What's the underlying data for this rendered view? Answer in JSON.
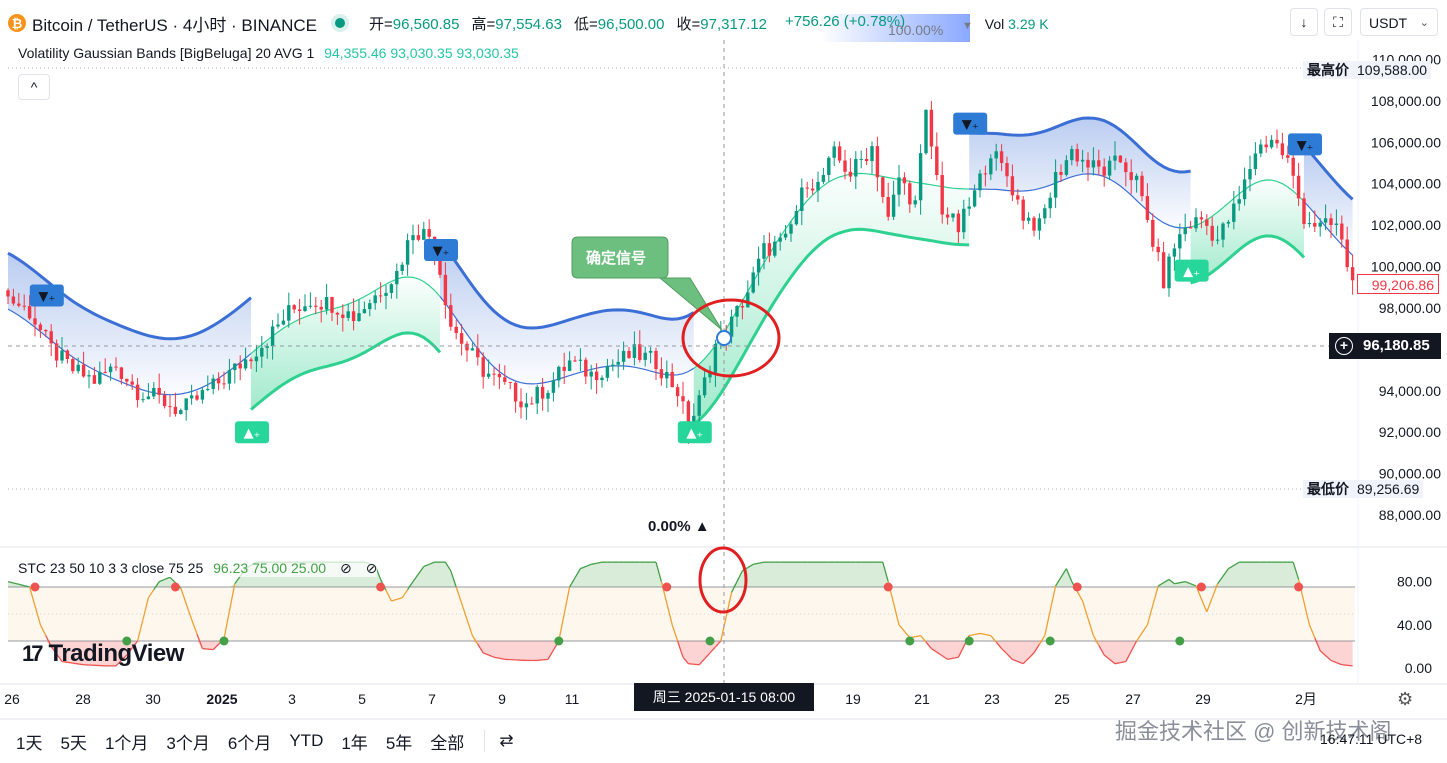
{
  "header": {
    "symbol": "Bitcoin / TetherUS · 4小时 · BINANCE",
    "coin_glyph": "₿",
    "open_label": "开=",
    "open": "96,560.85",
    "high_label": "高=",
    "high": "97,554.63",
    "low_label": "低=",
    "low": "96,500.00",
    "close_label": "收=",
    "close": "97,317.12",
    "change": "+756.26 (+0.78%)",
    "pct": "100.00%",
    "pct_triangle": "▼",
    "vol_label": "Vol",
    "vol": "3.29 K"
  },
  "toolbar": {
    "download_icon": "↓",
    "fullscreen_icon": "⛶",
    "currency": "USDT",
    "currency_chevron": "⌄"
  },
  "indicator": {
    "name": "Volatility Gaussian Bands [BigBeluga] 20 AVG 1",
    "v1": "94,355.46",
    "v2": "93,030.35",
    "v3": "93,030.35",
    "collapse": "^"
  },
  "stc": {
    "name": "STC 23 50 10 3 3 close 75 25",
    "v1": "96.23",
    "v2": "75.00",
    "v3": "25.00",
    "hide_icon": "⊘"
  },
  "annotation": {
    "callout": "确定信号",
    "pct_bottom": "0.00%  ▲"
  },
  "price_axis": {
    "ticks": [
      "110,000.00",
      "108,000.00",
      "106,000.00",
      "104,000.00",
      "102,000.00",
      "100,000.00",
      "98,000.00",
      "96,000.00",
      "94,000.00",
      "92,000.00",
      "90,000.00",
      "88,000.00"
    ],
    "high_label": "最高价",
    "high_value": "109,588.00",
    "low_label": "最低价",
    "low_value": "89,256.69",
    "last_price": "99,206.86",
    "crosshair_price": "96,180.85",
    "crosshair_plus": "+"
  },
  "stc_axis": {
    "ticks": [
      "80.00",
      "40.00",
      "0.00"
    ]
  },
  "time_axis": {
    "ticks": [
      "26",
      "28",
      "30",
      "2025",
      "3",
      "5",
      "7",
      "9",
      "11",
      "19",
      "21",
      "23",
      "25",
      "27",
      "29",
      "2月"
    ],
    "crosshair": "周三 2025-01-15   08:00",
    "settings_icon": "⚙"
  },
  "range_bar": {
    "items": [
      "1天",
      "5天",
      "1个月",
      "3个月",
      "6个月",
      "YTD",
      "1年",
      "5年",
      "全部"
    ],
    "compare_icon": "⇄"
  },
  "logo": {
    "mark": "17",
    "text": "TradingView"
  },
  "watermark": "掘金技术社区 @ 创新技术阁",
  "clock": "16:47:11 UTC+8",
  "colors": {
    "up": "#089981",
    "down": "#f23645",
    "upper_band": "#3b6fd6",
    "lower_band": "#2ed18f",
    "stc_up": "#43a047",
    "stc_down": "#ef5350",
    "stc_line": "#f0a030",
    "signal": "#2e7bd6",
    "callout": "#6dbf7f"
  },
  "chart_data": [
    {
      "type": "candlestick",
      "title": "Bitcoin / TetherUS · 4小时 · BINANCE",
      "ylim": [
        87000,
        111000
      ],
      "x_ticks": [
        "26",
        "28",
        "30",
        "2025",
        "3",
        "5",
        "7",
        "9",
        "11",
        "19",
        "21",
        "23",
        "25",
        "27",
        "29",
        "2月"
      ],
      "close_path": [
        [
          0,
          98500
        ],
        [
          4,
          97800
        ],
        [
          8,
          96000
        ],
        [
          12,
          95000
        ],
        [
          16,
          94500
        ],
        [
          20,
          95200
        ],
        [
          24,
          94000
        ],
        [
          28,
          93600
        ],
        [
          32,
          93000
        ],
        [
          36,
          93800
        ],
        [
          40,
          94600
        ],
        [
          44,
          95500
        ],
        [
          48,
          96500
        ],
        [
          52,
          97800
        ],
        [
          56,
          98400
        ],
        [
          60,
          98200
        ],
        [
          64,
          97600
        ],
        [
          68,
          98600
        ],
        [
          72,
          99700
        ],
        [
          75,
          101800
        ],
        [
          78,
          101500
        ],
        [
          80,
          99800
        ],
        [
          82,
          97200
        ],
        [
          85,
          96000
        ],
        [
          88,
          95000
        ],
        [
          92,
          94200
        ],
        [
          96,
          93400
        ],
        [
          100,
          94200
        ],
        [
          104,
          95400
        ],
        [
          108,
          94800
        ],
        [
          112,
          95300
        ],
        [
          116,
          95800
        ],
        [
          120,
          95400
        ],
        [
          124,
          94000
        ],
        [
          126,
          92200
        ],
        [
          128,
          93500
        ],
        [
          131,
          96200
        ],
        [
          134,
          97300
        ],
        [
          137,
          98800
        ],
        [
          140,
          100800
        ],
        [
          144,
          101200
        ],
        [
          148,
          104200
        ],
        [
          150,
          103900
        ],
        [
          153,
          105400
        ],
        [
          156,
          104500
        ],
        [
          160,
          105800
        ],
        [
          163,
          102200
        ],
        [
          165,
          104300
        ],
        [
          168,
          103000
        ],
        [
          170,
          107300
        ],
        [
          173,
          102800
        ],
        [
          176,
          101800
        ],
        [
          179,
          103500
        ],
        [
          182,
          105600
        ],
        [
          185,
          104400
        ],
        [
          188,
          102500
        ],
        [
          191,
          101900
        ],
        [
          194,
          104300
        ],
        [
          197,
          105600
        ],
        [
          200,
          104900
        ],
        [
          203,
          104600
        ],
        [
          206,
          105100
        ],
        [
          209,
          104100
        ],
        [
          212,
          101200
        ],
        [
          214,
          99300
        ],
        [
          216,
          101000
        ],
        [
          218,
          101900
        ],
        [
          221,
          102300
        ],
        [
          224,
          101300
        ],
        [
          228,
          103200
        ],
        [
          231,
          105600
        ],
        [
          234,
          106200
        ],
        [
          237,
          105100
        ],
        [
          240,
          102400
        ],
        [
          243,
          101900
        ],
        [
          246,
          102000
        ],
        [
          249,
          99200
        ]
      ],
      "range": {
        "high": 109588.0,
        "low": 89256.69
      },
      "last_price": 99206.86,
      "crosshair": {
        "date": "2025-01-15 08:00",
        "price": 96180.85
      },
      "series": [
        {
          "name": "Volatility Gaussian Bands [BigBeluga] 20 AVG 1",
          "values": [
            94355.46,
            93030.35,
            93030.35
          ]
        }
      ],
      "signals": [
        {
          "type": "sell",
          "bar": 7,
          "price": 98600
        },
        {
          "type": "buy",
          "bar": 45,
          "price": 92000
        },
        {
          "type": "sell",
          "bar": 80,
          "price": 100800
        },
        {
          "type": "buy",
          "bar": 127,
          "price": 92000
        },
        {
          "type": "sell",
          "bar": 178,
          "price": 106900
        },
        {
          "type": "buy",
          "bar": 219,
          "price": 99800
        },
        {
          "type": "sell",
          "bar": 240,
          "price": 105900
        }
      ]
    },
    {
      "type": "line",
      "title": "STC 23 50 10 3 3 close 75 25",
      "ylim": [
        0,
        100
      ],
      "series": [
        {
          "name": "STC",
          "values": [
            96.23,
            75.0,
            25.0
          ]
        }
      ],
      "path": [
        [
          0,
          80
        ],
        [
          4,
          75
        ],
        [
          6,
          40
        ],
        [
          8,
          20
        ],
        [
          10,
          6
        ],
        [
          14,
          3
        ],
        [
          18,
          2
        ],
        [
          20,
          2
        ],
        [
          22,
          12
        ],
        [
          24,
          25
        ],
        [
          26,
          65
        ],
        [
          28,
          80
        ],
        [
          30,
          84
        ],
        [
          32,
          74
        ],
        [
          34,
          45
        ],
        [
          36,
          18
        ],
        [
          38,
          17
        ],
        [
          40,
          27
        ],
        [
          42,
          78
        ],
        [
          44,
          92
        ],
        [
          46,
          98
        ],
        [
          50,
          98
        ],
        [
          54,
          98
        ],
        [
          58,
          98
        ],
        [
          62,
          98
        ],
        [
          64,
          98
        ],
        [
          66,
          98
        ],
        [
          68,
          95
        ],
        [
          69,
          82
        ],
        [
          71,
          62
        ],
        [
          73,
          65
        ],
        [
          75,
          80
        ],
        [
          77,
          94
        ],
        [
          79,
          98
        ],
        [
          81,
          98
        ],
        [
          82,
          90
        ],
        [
          84,
          60
        ],
        [
          86,
          30
        ],
        [
          88,
          14
        ],
        [
          90,
          10
        ],
        [
          92,
          8
        ],
        [
          96,
          7
        ],
        [
          98,
          7
        ],
        [
          100,
          8
        ],
        [
          102,
          25
        ],
        [
          104,
          75
        ],
        [
          106,
          92
        ],
        [
          108,
          96
        ],
        [
          110,
          98
        ],
        [
          114,
          98
        ],
        [
          118,
          98
        ],
        [
          120,
          98
        ],
        [
          121,
          80
        ],
        [
          123,
          40
        ],
        [
          125,
          10
        ],
        [
          126,
          4
        ],
        [
          128,
          3
        ],
        [
          130,
          14
        ],
        [
          132,
          25
        ],
        [
          134,
          70
        ],
        [
          136,
          90
        ],
        [
          138,
          96
        ],
        [
          140,
          98
        ],
        [
          144,
          98
        ],
        [
          150,
          98
        ],
        [
          156,
          98
        ],
        [
          162,
          98
        ],
        [
          163,
          80
        ],
        [
          165,
          40
        ],
        [
          167,
          28
        ],
        [
          169,
          30
        ],
        [
          171,
          18
        ],
        [
          174,
          8
        ],
        [
          176,
          10
        ],
        [
          178,
          30
        ],
        [
          180,
          32
        ],
        [
          182,
          30
        ],
        [
          184,
          18
        ],
        [
          186,
          8
        ],
        [
          188,
          4
        ],
        [
          190,
          14
        ],
        [
          192,
          30
        ],
        [
          194,
          76
        ],
        [
          196,
          92
        ],
        [
          197,
          80
        ],
        [
          199,
          62
        ],
        [
          201,
          30
        ],
        [
          203,
          12
        ],
        [
          205,
          4
        ],
        [
          207,
          6
        ],
        [
          209,
          25
        ],
        [
          211,
          40
        ],
        [
          213,
          76
        ],
        [
          215,
          82
        ],
        [
          216,
          78
        ],
        [
          218,
          80
        ],
        [
          220,
          76
        ],
        [
          222,
          52
        ],
        [
          224,
          78
        ],
        [
          226,
          92
        ],
        [
          228,
          98
        ],
        [
          232,
          98
        ],
        [
          236,
          98
        ],
        [
          238,
          98
        ],
        [
          239,
          82
        ],
        [
          241,
          40
        ],
        [
          243,
          16
        ],
        [
          245,
          7
        ],
        [
          247,
          3
        ],
        [
          249,
          2
        ]
      ],
      "markers": [
        {
          "bar": 5,
          "value": 75,
          "type": "cross_down"
        },
        {
          "bar": 22,
          "value": 25,
          "type": "cross_up"
        },
        {
          "bar": 31,
          "value": 75,
          "type": "cross_down"
        },
        {
          "bar": 40,
          "value": 25,
          "type": "cross_up"
        },
        {
          "bar": 69,
          "value": 75,
          "type": "cross_down"
        },
        {
          "bar": 102,
          "value": 25,
          "type": "cross_up"
        },
        {
          "bar": 122,
          "value": 75,
          "type": "cross_down"
        },
        {
          "bar": 130,
          "value": 25,
          "type": "cross_up"
        },
        {
          "bar": 163,
          "value": 75,
          "type": "cross_down"
        },
        {
          "bar": 167,
          "value": 25,
          "type": "cross_up"
        },
        {
          "bar": 178,
          "value": 25,
          "type": "cross_up"
        },
        {
          "bar": 193,
          "value": 25,
          "type": "cross_up"
        },
        {
          "bar": 198,
          "value": 75,
          "type": "cross_down"
        },
        {
          "bar": 217,
          "value": 25,
          "type": "cross_up"
        },
        {
          "bar": 221,
          "value": 75,
          "type": "cross_down"
        },
        {
          "bar": 239,
          "value": 75,
          "type": "cross_down"
        }
      ]
    }
  ]
}
